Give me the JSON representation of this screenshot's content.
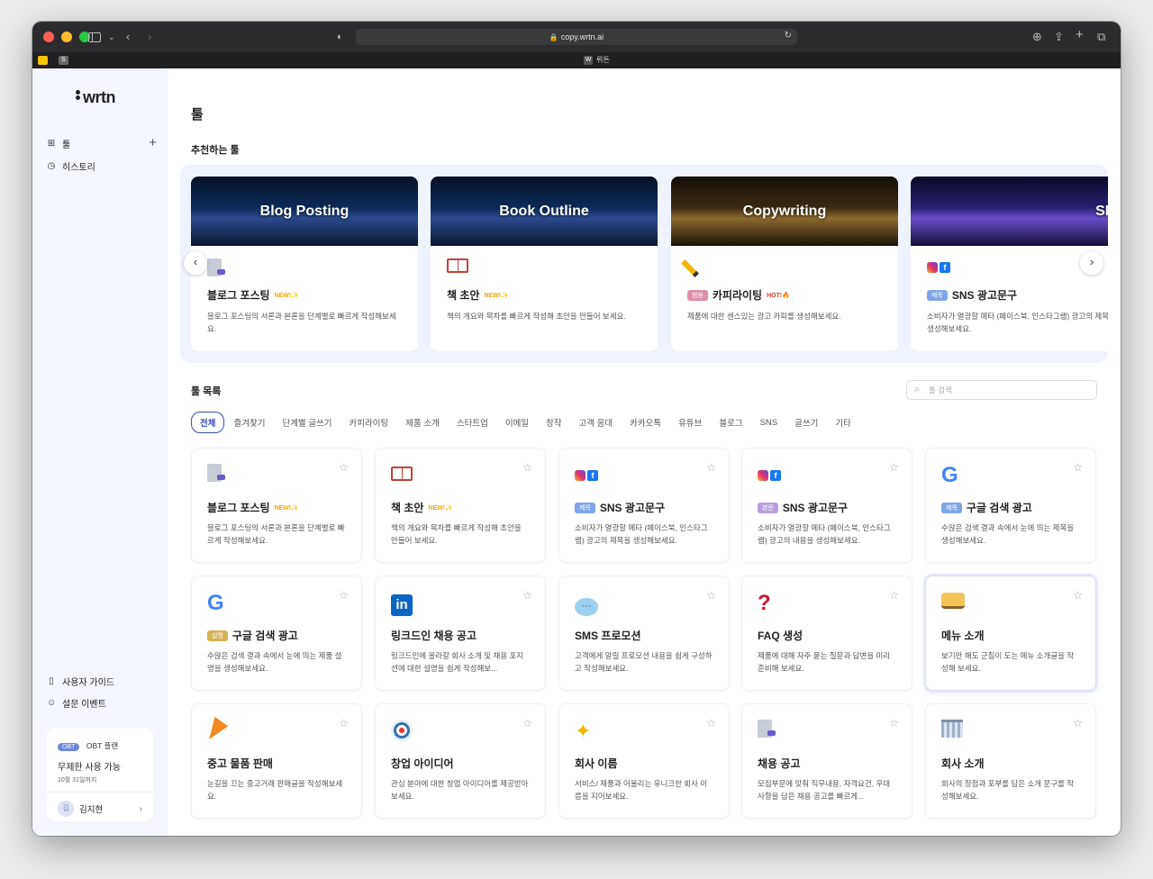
{
  "browser": {
    "url": "copy.wrtn.ai",
    "tab_title": "뤼튼",
    "tab_favicon": "W"
  },
  "sidebar": {
    "logo": "wrtn",
    "nav": [
      {
        "label": "툴",
        "icon": "grid-icon"
      },
      {
        "label": "히스토리",
        "icon": "clock-icon"
      }
    ],
    "bottom_links": [
      {
        "label": "사용자 가이드",
        "icon": "book-icon"
      },
      {
        "label": "설문 이벤트",
        "icon": "smile-icon"
      }
    ],
    "plan": {
      "badge": "OBT",
      "name": "OBT 플랜",
      "title": "무제한 사용 가능",
      "date": "10월 31일까지",
      "user_initial": "김",
      "user_name": "김지현"
    }
  },
  "main": {
    "title": "툴",
    "recommended_title": "추천하는 툴",
    "featured": [
      {
        "banner": "Blog Posting",
        "title": "블로그 포스팅",
        "tag": "NEW!✨",
        "tag_type": "new",
        "badge": "",
        "icon": "document-icon",
        "desc": "블로그 포스팅의 서론과 본론을 단계별로 빠르게 작성해보세요."
      },
      {
        "banner": "Book Outline",
        "title": "책 초안",
        "tag": "NEW!✨",
        "tag_type": "new",
        "badge": "",
        "icon": "book-icon",
        "desc": "책의 개요와 목차를 빠르게 작성해 초안을 만들어 보세요."
      },
      {
        "banner": "Copywriting",
        "title": "카피라이팅",
        "tag": "HOT!🔥",
        "tag_type": "hot",
        "badge": "범용",
        "icon": "pencil-icon",
        "desc": "제품에 대한 센스있는 광고 카피를 생성해보세요."
      },
      {
        "banner": "SNS",
        "title": "SNS 광고문구",
        "tag": "",
        "tag_type": "",
        "badge": "제목",
        "icon": "instagram-facebook-icon",
        "desc": "소비자가 열광할 메타 (페이스북, 인스타그램) 광고의 제목을 생성해보세요."
      }
    ],
    "list_title": "툴 목록",
    "search_placeholder": "툴 검색",
    "filters": [
      "전체",
      "즐겨찾기",
      "단계별 글쓰기",
      "카피라이팅",
      "제품 소개",
      "스타트업",
      "이메일",
      "창작",
      "고객 응대",
      "카카오톡",
      "유튜브",
      "블로그",
      "SNS",
      "글쓰기",
      "기타"
    ],
    "active_filter": "전체",
    "tools": [
      {
        "title": "블로그 포스팅",
        "tag": "NEW!✨",
        "badge": "",
        "badge_color": "",
        "icon": "document-icon",
        "desc": "블로그 포스팅의 서론과 본론을 단계별로 빠르게 작성해보세요."
      },
      {
        "title": "책 초안",
        "tag": "NEW!✨",
        "badge": "",
        "badge_color": "",
        "icon": "book-icon",
        "desc": "책의 개요와 목차를 빠르게 작성해 초안을 만들어 보세요."
      },
      {
        "title": "SNS 광고문구",
        "tag": "",
        "badge": "제목",
        "badge_color": "blue",
        "icon": "instagram-facebook-icon",
        "desc": "소비자가 열광할 메타 (페이스북, 인스타그램) 광고의 제목을 생성해보세요."
      },
      {
        "title": "SNS 광고문구",
        "tag": "",
        "badge": "본문",
        "badge_color": "purple",
        "icon": "instagram-facebook-icon",
        "desc": "소비자가 열광할 메타 (페이스북, 인스타그램) 광고의 내용을 생성해보세요."
      },
      {
        "title": "구글 검색 광고",
        "tag": "",
        "badge": "제목",
        "badge_color": "blue",
        "icon": "google-icon",
        "desc": "수많은 검색 결과 속에서 눈에 띄는 제목을 생성해보세요."
      },
      {
        "title": "구글 검색 광고",
        "tag": "",
        "badge": "설명",
        "badge_color": "gold",
        "icon": "google-icon",
        "desc": "수많은 검색 결과 속에서 눈에 띄는 제품 설명을 생성해보세요."
      },
      {
        "title": "링크드인 채용 공고",
        "tag": "",
        "badge": "",
        "badge_color": "",
        "icon": "linkedin-icon",
        "desc": "링크드인에 올라갈 회사 소개 및 채용 포지션에 대한 설명을 쉽게 작성해보..."
      },
      {
        "title": "SMS 프로모션",
        "tag": "",
        "badge": "",
        "badge_color": "",
        "icon": "speech-bubble-icon",
        "desc": "고객에게 알릴 프로모션 내용을 쉽게 구성하고 작성해보세요."
      },
      {
        "title": "FAQ 생성",
        "tag": "",
        "badge": "",
        "badge_color": "",
        "icon": "question-icon",
        "desc": "제품에 대해 자주 묻는 질문과 답변을 미리 준비해 보세요."
      },
      {
        "title": "메뉴 소개",
        "tag": "",
        "badge": "",
        "badge_color": "",
        "icon": "sandwich-icon",
        "desc": "보기만 해도 군침이 도는 메뉴 소개글을 작성해 보세요."
      },
      {
        "title": "중고 물품 판매",
        "tag": "",
        "badge": "",
        "badge_color": "",
        "icon": "carrot-icon",
        "desc": "눈길을 끄는 중고거래 판매글을 작성해보세요."
      },
      {
        "title": "창업 아이디어",
        "tag": "",
        "badge": "",
        "badge_color": "",
        "icon": "target-icon",
        "desc": "관심 분야에 대한 창업 아이디어를 제공받아 보세요."
      },
      {
        "title": "회사 이름",
        "tag": "",
        "badge": "",
        "badge_color": "",
        "icon": "sparkles-icon",
        "desc": "서비스/ 제품과 어울리는 유니크한 회사 이름을 지어보세요."
      },
      {
        "title": "채용 공고",
        "tag": "",
        "badge": "",
        "badge_color": "",
        "icon": "document-icon",
        "desc": "모집부문에 맞춰 직무내용, 자격요건, 우대사항을 담은 채용 공고를 빠르게..."
      },
      {
        "title": "회사 소개",
        "tag": "",
        "badge": "",
        "badge_color": "",
        "icon": "building-icon",
        "desc": "회사의 장점과 포부를 담은 소개 문구를 작성해보세요."
      }
    ]
  }
}
